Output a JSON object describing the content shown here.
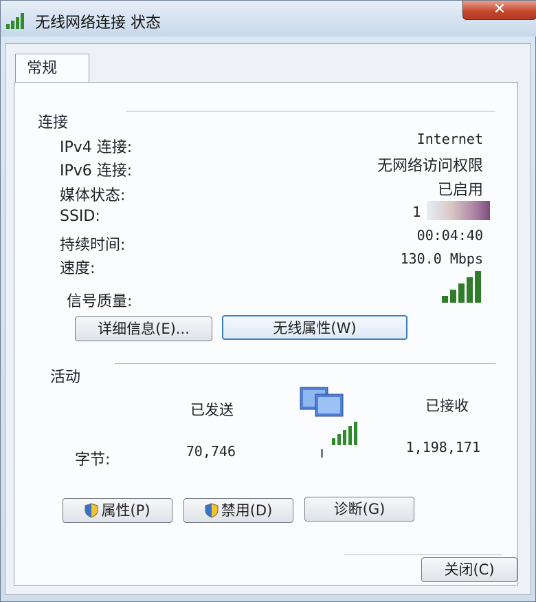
{
  "window": {
    "title": "无线网络连接 状态",
    "close_label": "✕"
  },
  "tab": {
    "label": "常规"
  },
  "connection": {
    "section_label": "连接",
    "rows": [
      {
        "label": "IPv4 连接:",
        "value": "Internet"
      },
      {
        "label": "IPv6 连接:",
        "value": "无网络访问权限"
      },
      {
        "label": "媒体状态:",
        "value": "已启用"
      },
      {
        "label": "SSID:",
        "value": "1"
      },
      {
        "label": "持续时间:",
        "value": "00:04:40"
      },
      {
        "label": "速度:",
        "value": "130.0 Mbps"
      }
    ],
    "signal_label": "信号质量:",
    "signal_level": 5,
    "signal_max": 5,
    "details_button": "详细信息(E)...",
    "wireless_props_button": "无线属性(W)"
  },
  "activity": {
    "section_label": "活动",
    "sent_label": "已发送",
    "received_label": "已接收",
    "bytes_label": "字节:",
    "bytes_sent": "70,746",
    "bytes_received": "1,198,171"
  },
  "buttons": {
    "properties": "属性(P)",
    "disable": "禁用(D)",
    "diagnose": "诊断(G)",
    "close": "关闭(C)"
  },
  "colors": {
    "signal_green": "#2f7d2a",
    "accent_blue": "#3b7fc4"
  }
}
